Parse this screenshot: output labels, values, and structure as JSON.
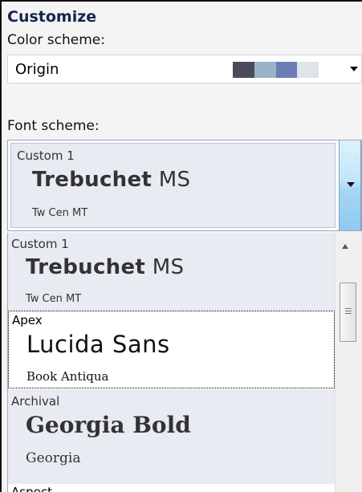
{
  "panel": {
    "title": "Customize",
    "color_scheme_label": "Color scheme:",
    "font_scheme_label": "Font scheme:"
  },
  "color_scheme": {
    "value": "Origin",
    "swatches": [
      "#4b4b5d",
      "#9bb3c9",
      "#6a7eb4",
      "#dde4ea"
    ]
  },
  "font_scheme": {
    "selected": {
      "name": "Custom 1",
      "heading_bold": "Trebuchet",
      "heading_rest": " MS",
      "body": "Tw Cen MT"
    },
    "list": [
      {
        "name": "Custom 1",
        "heading_bold": "Trebuchet",
        "heading_rest": " MS",
        "body": "Tw Cen MT"
      },
      {
        "name": "Apex",
        "heading": "Lucida Sans",
        "body": "Book Antiqua"
      },
      {
        "name": "Archival",
        "heading": "Georgia Bold",
        "body": "Georgia"
      },
      {
        "name": "Aspect"
      }
    ]
  },
  "icons": {
    "dropdown": "chevron-down-icon",
    "scroll_up": "scroll-up-arrow-icon",
    "thumb_grip": "grip-icon"
  }
}
